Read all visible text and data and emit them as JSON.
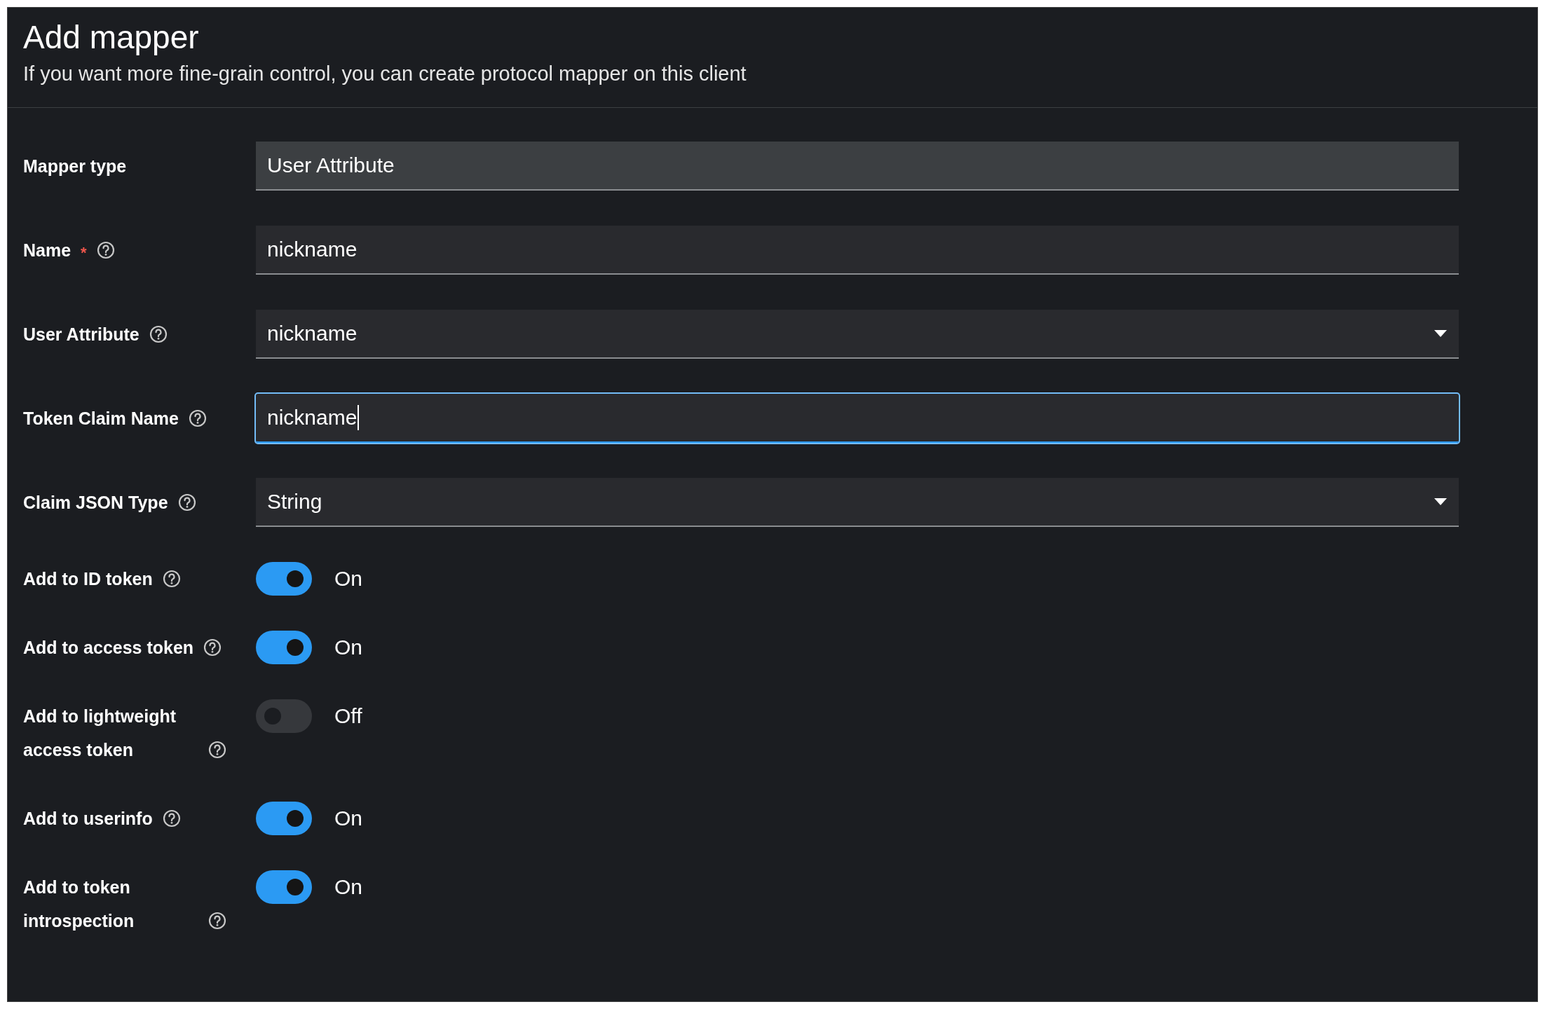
{
  "header": {
    "title": "Add mapper",
    "subtitle": "If you want more fine-grain control, you can create protocol mapper on this client"
  },
  "fields": [
    {
      "label": "Mapper type",
      "kind": "readonly",
      "value": "User Attribute",
      "help": false,
      "focused": false
    },
    {
      "label": "Name",
      "required_mark": "*",
      "kind": "text",
      "value": "nickname",
      "help": true,
      "focused": false
    },
    {
      "label": "User Attribute",
      "kind": "select",
      "value": "nickname",
      "help": true,
      "focused": false
    },
    {
      "label": "Token Claim Name",
      "kind": "text",
      "value": "nickname",
      "help": true,
      "focused": true
    },
    {
      "label": "Claim JSON Type",
      "kind": "select",
      "value": "String",
      "help": true,
      "focused": false
    }
  ],
  "toggles": [
    {
      "label": "Add to ID token",
      "on": true,
      "state": "On"
    },
    {
      "label": "Add to access token",
      "on": true,
      "state": "On"
    },
    {
      "label": "Add to lightweight access token",
      "on": false,
      "state": "Off"
    },
    {
      "label": "Add to userinfo",
      "on": true,
      "state": "On"
    },
    {
      "label": "Add to token introspection",
      "on": true,
      "state": "On"
    }
  ]
}
